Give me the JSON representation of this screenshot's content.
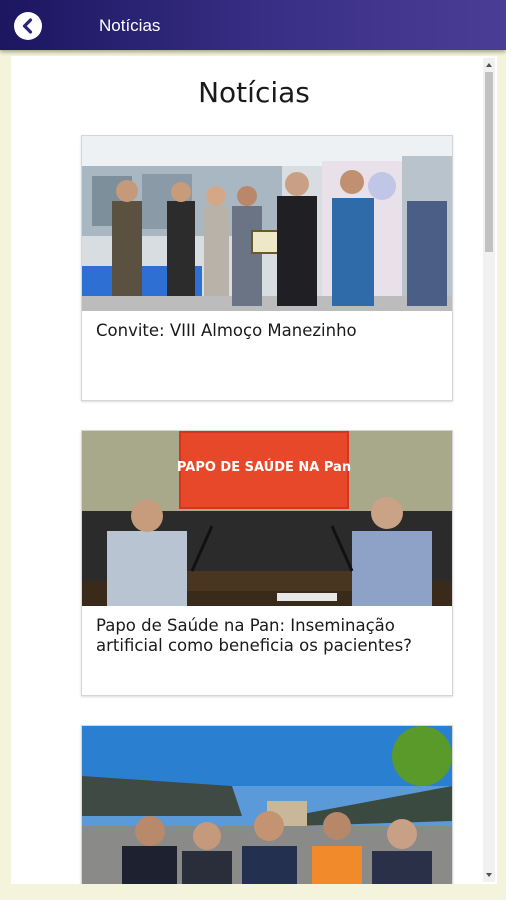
{
  "appbar": {
    "title": "Notícias",
    "back_icon": "chevron-left-icon"
  },
  "page": {
    "title": "Notícias"
  },
  "news": [
    {
      "title": "Convite: VIII Almoço Manezinho"
    },
    {
      "title": "Papo de Saúde na Pan: Inseminação artificial como beneficia os pacientes?",
      "screen_text": "PAPO DE SAÚDE NA Pan"
    },
    {
      "title": ""
    }
  ],
  "colors": {
    "appbar": "#2a237a",
    "background": "#f4f4dc"
  }
}
